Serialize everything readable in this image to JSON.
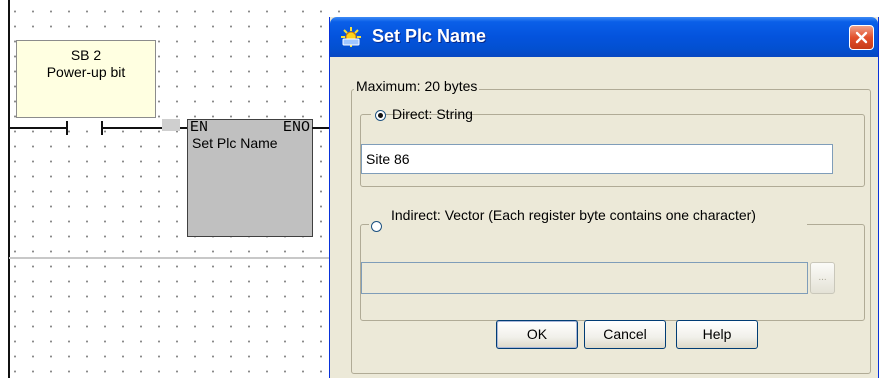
{
  "ladder": {
    "sb_line1": "SB 2",
    "sb_line2": "Power-up bit",
    "fb_en": "EN",
    "fb_eno": "ENO",
    "fb_name": "Set Plc Name"
  },
  "dialog": {
    "title": "Set Plc Name",
    "max_label": "Maximum: 20 bytes",
    "direct": {
      "label": "Direct: String",
      "selected": true,
      "value": "Site 86"
    },
    "indirect": {
      "label": "Indirect: Vector (Each register byte contains one character)",
      "selected": false,
      "value": "",
      "browse_label": "..."
    },
    "buttons": {
      "ok": "OK",
      "cancel": "Cancel",
      "help": "Help"
    }
  },
  "colors": {
    "title_bar": "#0453dd",
    "dialog_bg": "#ece9d8",
    "note_bg": "#ffffe1",
    "close_button": "#e2502c"
  },
  "icons": [
    "plc-sun-icon",
    "close-icon",
    "radio-icon"
  ]
}
